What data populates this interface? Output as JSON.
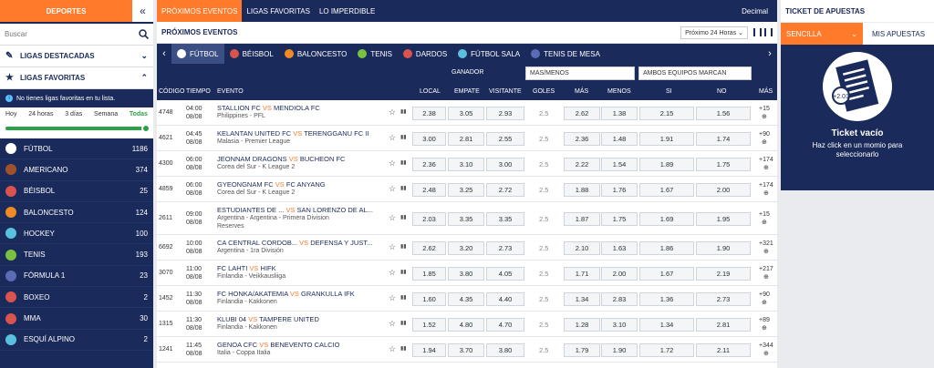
{
  "left": {
    "title": "DEPORTES",
    "collapse": "«",
    "search_placeholder": "Buscar",
    "destacadas": "LIGAS DESTACADAS",
    "favoritas": "LIGAS FAVORITAS",
    "nofav": "No tienes ligas favoritas en tu lista.",
    "time": [
      "Hoy",
      "24 horas",
      "3 días",
      "Semana",
      "Todas"
    ],
    "sports": [
      {
        "name": "FÚTBOL",
        "count": "1186",
        "color": "#ffffff"
      },
      {
        "name": "AMERICANO",
        "count": "374",
        "color": "#a0522d"
      },
      {
        "name": "BÉISBOL",
        "count": "25",
        "color": "#d9534f"
      },
      {
        "name": "BALONCESTO",
        "count": "124",
        "color": "#f08a24"
      },
      {
        "name": "HOCKEY",
        "count": "100",
        "color": "#5bc0de"
      },
      {
        "name": "TENIS",
        "count": "193",
        "color": "#7ac142"
      },
      {
        "name": "FÓRMULA 1",
        "count": "23",
        "color": "#5b6bb5"
      },
      {
        "name": "BOXEO",
        "count": "2",
        "color": "#d9534f"
      },
      {
        "name": "MMA",
        "count": "30",
        "color": "#d9534f"
      },
      {
        "name": "ESQUÍ ALPINO",
        "count": "2",
        "color": "#5bc0de"
      }
    ]
  },
  "nav": {
    "tabs": [
      "PRÓXIMOS EVENTOS",
      "LIGAS FAVORITAS",
      "LO IMPERDIBLE"
    ],
    "decimal": "Decimal"
  },
  "section": {
    "title": "PRÓXIMOS EVENTOS",
    "range": "Próximo 24 Horas ⌄"
  },
  "sportsbar": [
    {
      "name": "FÚTBOL",
      "color": "#ffffff"
    },
    {
      "name": "BÉISBOL",
      "color": "#d9534f"
    },
    {
      "name": "BALONCESTO",
      "color": "#f08a24"
    },
    {
      "name": "TENIS",
      "color": "#7ac142"
    },
    {
      "name": "DARDOS",
      "color": "#d9534f"
    },
    {
      "name": "FÚTBOL SALA",
      "color": "#5bc0de"
    },
    {
      "name": "TENIS DE MESA",
      "color": "#5b6bb5"
    }
  ],
  "table": {
    "ganador": "GANADOR",
    "dd1": "MAS/MENOS",
    "dd2": "AMBOS EQUIPOS MARCAN",
    "headers": [
      "CÓDIGO",
      "TIEMPO",
      "EVENTO",
      "LOCAL",
      "EMPATE",
      "VISITANTE",
      "GOLES",
      "MÁS",
      "MENOS",
      "SI",
      "NO",
      "MÁS"
    ],
    "rows": [
      {
        "code": "4748",
        "time": "04:00",
        "date": "08/08",
        "home": "STALLION FC",
        "away": "MENDIOLA FC",
        "league": "Philippines - PFL",
        "o": [
          "2.38",
          "3.05",
          "2.93",
          "2.5",
          "2.62",
          "1.38",
          "2.15",
          "1.56"
        ],
        "more": "+15"
      },
      {
        "code": "4621",
        "time": "04:45",
        "date": "08/08",
        "home": "KELANTAN UNITED FC",
        "away": "TERENGGANU FC II",
        "league": "Malasia - Premier League",
        "o": [
          "3.00",
          "2.81",
          "2.55",
          "2.5",
          "2.36",
          "1.48",
          "1.91",
          "1.74"
        ],
        "more": "+90"
      },
      {
        "code": "4300",
        "time": "06:00",
        "date": "08/08",
        "home": "JEONNAM DRAGONS",
        "away": "BUCHEON FC",
        "league": "Corea del Sur - K League 2",
        "o": [
          "2.36",
          "3.10",
          "3.00",
          "2.5",
          "2.22",
          "1.54",
          "1.89",
          "1.75"
        ],
        "more": "+174"
      },
      {
        "code": "4859",
        "time": "06:00",
        "date": "08/08",
        "home": "GYEONGNAM FC",
        "away": "FC ANYANG",
        "league": "Corea del Sur - K League 2",
        "o": [
          "2.48",
          "3.25",
          "2.72",
          "2.5",
          "1.88",
          "1.76",
          "1.67",
          "2.00"
        ],
        "more": "+174"
      },
      {
        "code": "2611",
        "time": "09:00",
        "date": "08/08",
        "home": "ESTUDIANTES DE ...",
        "away": "SAN LORENZO DE AL...",
        "league": "Argentina - Argentina - Primera Division",
        "league2": "Reserves",
        "o": [
          "2.03",
          "3.35",
          "3.35",
          "2.5",
          "1.87",
          "1.75",
          "1.69",
          "1.95"
        ],
        "more": "+15"
      },
      {
        "code": "6692",
        "time": "10:00",
        "date": "08/08",
        "home": "CA CENTRAL CORDOB...",
        "away": "DEFENSA Y JUST...",
        "league": "Argentina - 1ra División",
        "o": [
          "2.62",
          "3.20",
          "2.73",
          "2.5",
          "2.10",
          "1.63",
          "1.86",
          "1.90"
        ],
        "more": "+321"
      },
      {
        "code": "3070",
        "time": "11:00",
        "date": "08/08",
        "home": "FC LAHTI",
        "away": "HIFK",
        "league": "Finlandia - Veikkausliiga",
        "o": [
          "1.85",
          "3.80",
          "4.05",
          "2.5",
          "1.71",
          "2.00",
          "1.67",
          "2.19"
        ],
        "more": "+217"
      },
      {
        "code": "1452",
        "time": "11:30",
        "date": "08/08",
        "home": "FC HONKA/AKATEMIA",
        "away": "GRANKULLA IFK",
        "league": "Finlandia - Kakkonen",
        "o": [
          "1.60",
          "4.35",
          "4.40",
          "2.5",
          "1.34",
          "2.83",
          "1.36",
          "2.73"
        ],
        "more": "+90"
      },
      {
        "code": "1315",
        "time": "11:30",
        "date": "08/08",
        "home": "KLUBI 04",
        "away": "TAMPERE UNITED",
        "league": "Finlandia - Kakkonen",
        "o": [
          "1.52",
          "4.80",
          "4.70",
          "2.5",
          "1.28",
          "3.10",
          "1.34",
          "2.81"
        ],
        "more": "+89"
      },
      {
        "code": "1241",
        "time": "11:45",
        "date": "08/08",
        "home": "GENOA CFC",
        "away": "BENEVENTO CALCIO",
        "league": "Italia - Coppa Italia",
        "o": [
          "1.94",
          "3.70",
          "3.80",
          "2.5",
          "1.79",
          "1.90",
          "1.72",
          "2.11"
        ],
        "more": "+344"
      }
    ]
  },
  "right": {
    "title": "TICKET DE APUESTAS",
    "tab1": "SENCILLA",
    "tab2": "MIS APUESTAS",
    "empty": "Ticket vacío",
    "hint": "Haz click en un momio para seleccionarlo",
    "slip_value": "+2.01"
  }
}
